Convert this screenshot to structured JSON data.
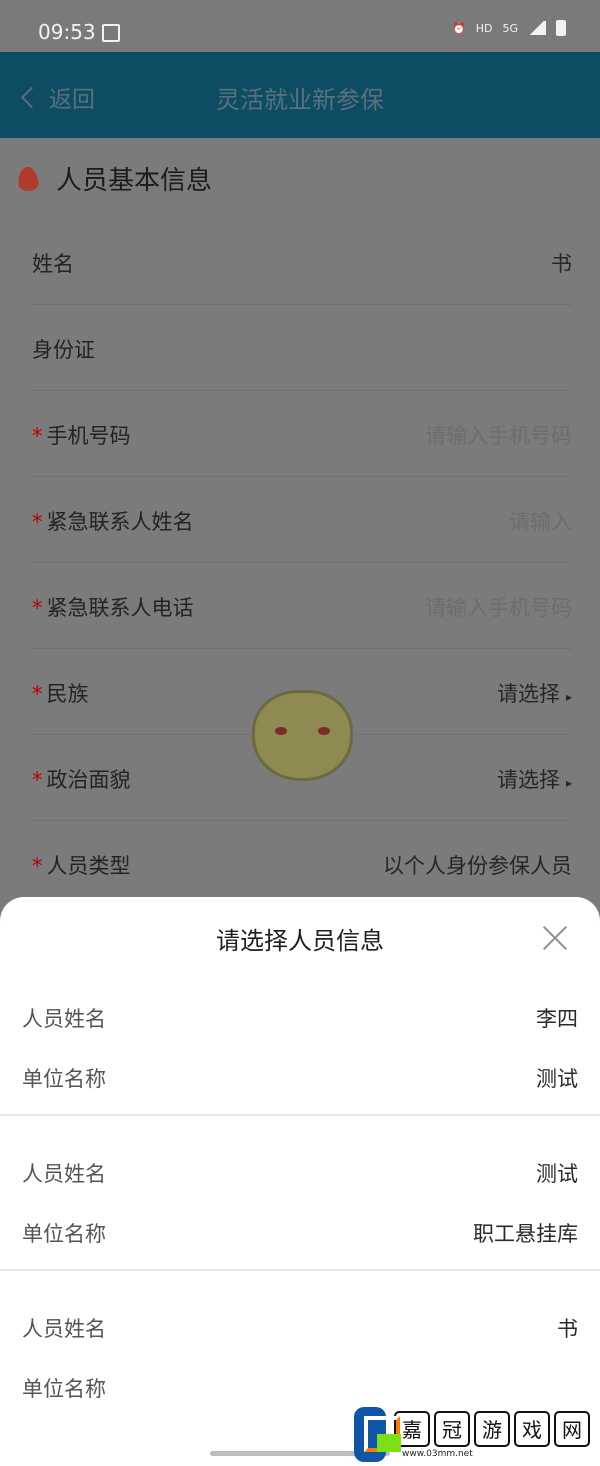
{
  "status": {
    "time": "09:53",
    "right_icons": [
      "alarm-icon",
      "HD",
      "5G",
      "signal-icon",
      "battery-icon"
    ]
  },
  "header": {
    "back_label": "返回",
    "title": "灵活就业新参保"
  },
  "section": {
    "title": "人员基本信息"
  },
  "form": {
    "rows": [
      {
        "label": "姓名",
        "value": "书"
      },
      {
        "label": "身份证",
        "value": ""
      },
      {
        "label": "手机号码",
        "placeholder": "请输入手机号码"
      },
      {
        "label": "紧急联系人姓名",
        "placeholder": "请输入"
      },
      {
        "label": "紧急联系人电话",
        "placeholder": "请输入手机号码"
      },
      {
        "label": "民族",
        "value": "请选择"
      },
      {
        "label": "政治面貌",
        "value": "请选择"
      },
      {
        "label": "人员类型",
        "value": "以个人身份参保人员"
      }
    ]
  },
  "sheet": {
    "title": "请选择人员信息",
    "items": [
      {
        "name_label": "人员姓名",
        "name": "李四",
        "unit_label": "单位名称",
        "unit": "测试"
      },
      {
        "name_label": "人员姓名",
        "name": "测试",
        "unit_label": "单位名称",
        "unit": "职工悬挂库"
      },
      {
        "name_label": "人员姓名",
        "name": "书",
        "unit_label": "单位名称",
        "unit": ""
      }
    ]
  },
  "watermark": {
    "chars": [
      "嘉",
      "冠",
      "游",
      "戏",
      "网"
    ],
    "url": "www.03mm.net"
  },
  "colors": {
    "header_bg": "#0e4c64",
    "required_star": "#b00",
    "sheet_bg": "#ffffff"
  }
}
